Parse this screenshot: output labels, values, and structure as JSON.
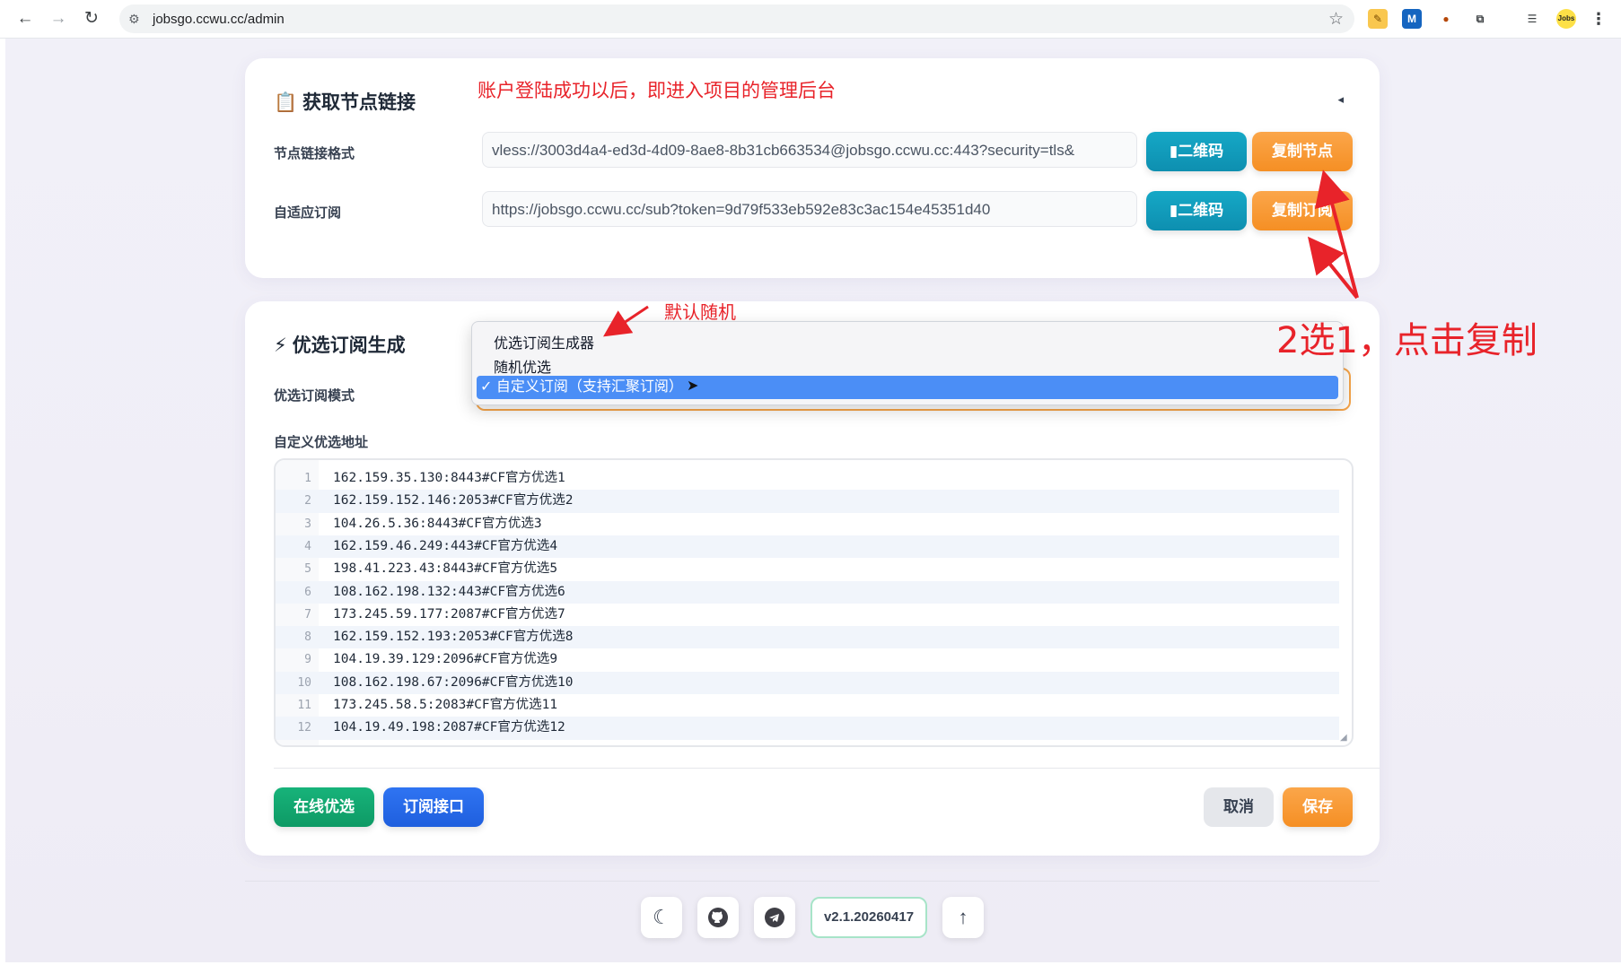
{
  "browser": {
    "url": "jobsgo.ccwu.cc/admin",
    "back_icon": "arrow-left-icon",
    "forward_icon": "arrow-right-icon",
    "reload_icon": "reload-icon"
  },
  "node_card": {
    "title": "📋 获取节点链接",
    "node_format_label": "节点链接格式",
    "node_format_value": "vless://3003d4a4-ed3d-4d09-8ae8-8b31cb663534@jobsgo.ccwu.cc:443?security=tls&",
    "subscribe_label": "自适应订阅",
    "subscribe_value": "https://jobsgo.ccwu.cc/sub?token=9d79f533eb592e83c3ac154e45351d40",
    "qr_label": "▮二维码",
    "copy_node_label": "复制节点",
    "copy_sub_label": "复制订阅",
    "collapse_icon": "◂"
  },
  "annotations": {
    "login_note": "账户登陆成功以后，即进入项目的管理后台",
    "default_random": "默认随机",
    "choose_copy": "2选1，点击复制"
  },
  "preferred_card": {
    "title": "⚡ 优选订阅生成",
    "mode_label": "优选订阅模式",
    "custom_address_label": "自定义优选地址",
    "options": [
      "优选订阅生成器",
      "随机优选",
      "自定义订阅（支持汇聚订阅）"
    ],
    "selected_option": "✓ 自定义订阅（支持汇聚订阅）",
    "code_lines": [
      {
        "n": "1",
        "text": "162.159.35.130:8443#CF官方优选1"
      },
      {
        "n": "2",
        "text": "162.159.152.146:2053#CF官方优选2"
      },
      {
        "n": "3",
        "text": "104.26.5.36:8443#CF官方优选3"
      },
      {
        "n": "4",
        "text": "162.159.46.249:443#CF官方优选4"
      },
      {
        "n": "5",
        "text": "198.41.223.43:8443#CF官方优选5"
      },
      {
        "n": "6",
        "text": "108.162.198.132:443#CF官方优选6"
      },
      {
        "n": "7",
        "text": "173.245.59.177:2087#CF官方优选7"
      },
      {
        "n": "8",
        "text": "162.159.152.193:2053#CF官方优选8"
      },
      {
        "n": "9",
        "text": "104.19.39.129:2096#CF官方优选9"
      },
      {
        "n": "10",
        "text": "108.162.198.67:2096#CF官方优选10"
      },
      {
        "n": "11",
        "text": "173.245.58.5:2083#CF官方优选11"
      },
      {
        "n": "12",
        "text": "104.19.49.198:2087#CF官方优选12"
      }
    ],
    "online_btn": "在线优选",
    "subscribe_api_btn": "订阅接口",
    "cancel_btn": "取消",
    "save_btn": "保存"
  },
  "footer": {
    "version": "v2.1.20260417",
    "theme_icon": "moon-icon",
    "github_icon": "github-icon",
    "telegram_icon": "telegram-icon",
    "up_icon": "arrow-up-icon"
  },
  "colors": {
    "accent_orange": "#f58f24",
    "accent_teal": "#0e8fb0",
    "annotation_red": "#e8232a",
    "select_highlight": "#4b8ef6"
  }
}
